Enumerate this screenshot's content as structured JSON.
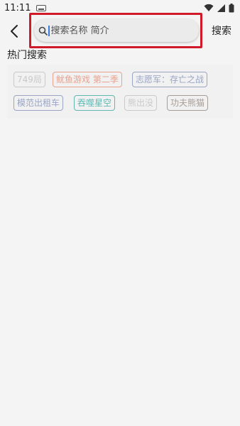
{
  "status_bar": {
    "time": "11:11",
    "icons": [
      "keyboard-icon",
      "wifi-icon",
      "signal-icon",
      "battery-icon"
    ]
  },
  "search": {
    "placeholder": "搜索名称 简介",
    "value": "",
    "button_label": "搜索"
  },
  "hot": {
    "title": "热门搜索",
    "tags": [
      {
        "label": "749局",
        "color": "#c9c9c9"
      },
      {
        "label": "鱿鱼游戏 第二季",
        "color": "#e8a28f"
      },
      {
        "label": "志愿军：存亡之战",
        "color": "#9aa5c6"
      },
      {
        "label": "模范出租车",
        "color": "#9aa5c6"
      },
      {
        "label": "吞噬星空",
        "color": "#5fb8b2"
      },
      {
        "label": "熊出没",
        "color": "#c9c9c9"
      },
      {
        "label": "功夫熊猫",
        "color": "#a79d96"
      }
    ]
  },
  "colors": {
    "highlight": "#d01a2a",
    "caret": "#3a7ad8"
  }
}
